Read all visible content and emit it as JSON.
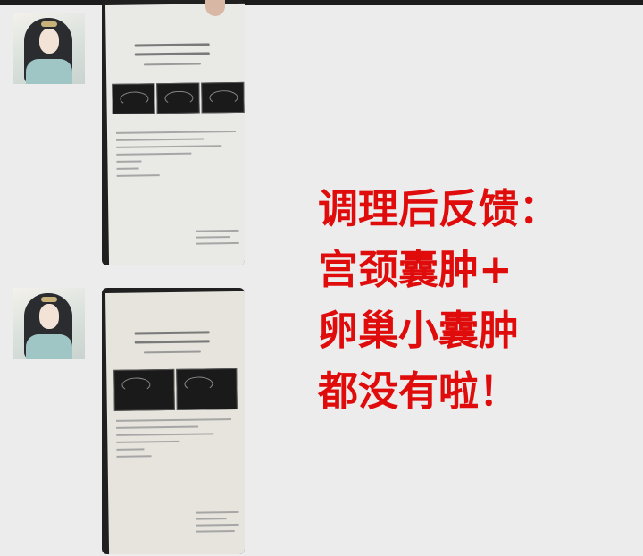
{
  "caption": {
    "line1": "调理后反馈：",
    "line2": "宫颈囊肿+",
    "line3": "卵巢小囊肿",
    "line4": "都没有啦！",
    "color": "#e00b0b"
  },
  "messages": [
    {
      "sender_icon": "avatar-icon",
      "content": "report-photo-before"
    },
    {
      "sender_icon": "avatar-icon",
      "content": "report-photo-after"
    }
  ],
  "colors": {
    "background": "#ececec",
    "top_bar": "#1c1c1c"
  }
}
